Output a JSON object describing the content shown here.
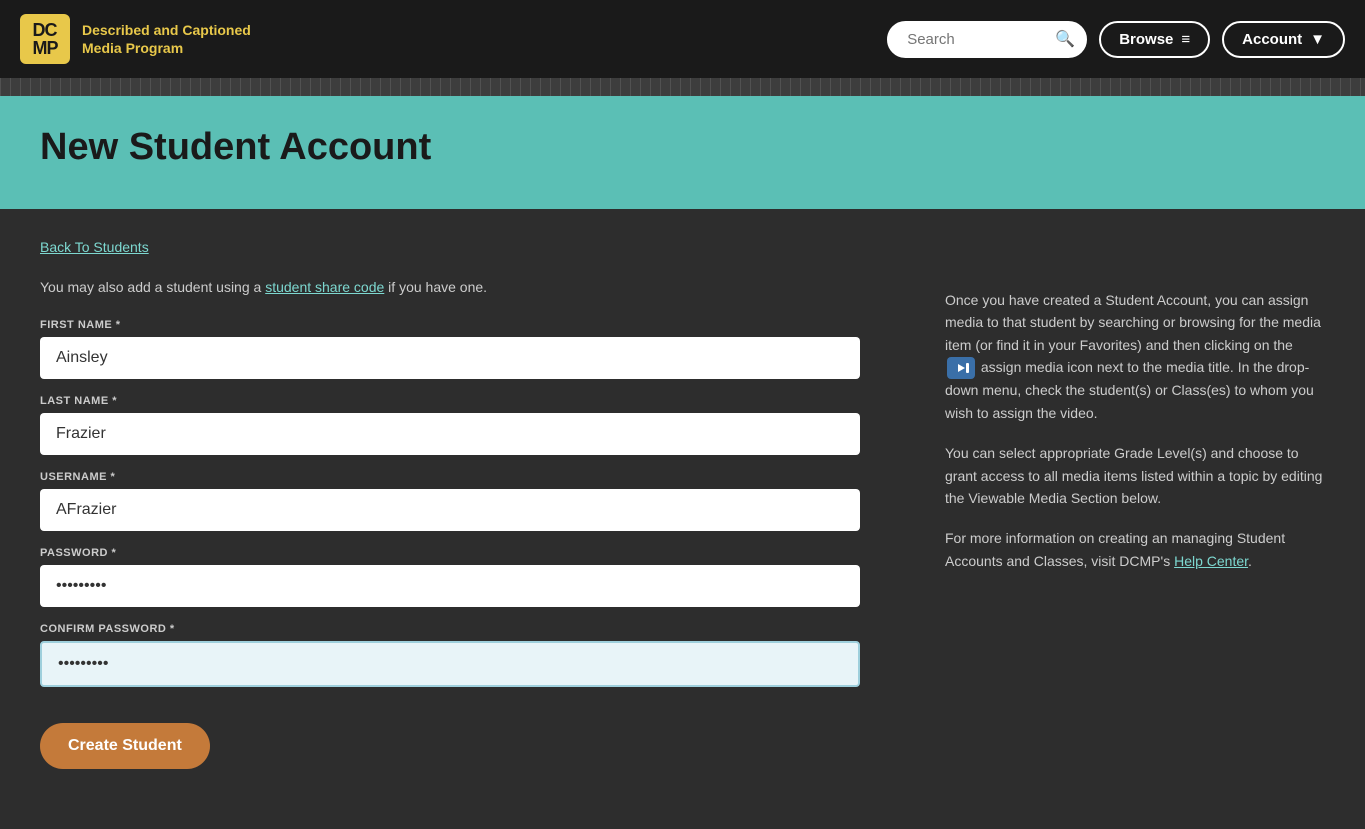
{
  "header": {
    "logo_initials": "DC\nMP",
    "logo_title_part1": "Described and Captioned",
    "logo_title_highlight": "d",
    "logo_title_part2": " Media Program",
    "search_placeholder": "Search",
    "browse_label": "Browse",
    "account_label": "Account"
  },
  "banner": {
    "title": "New Student Account"
  },
  "form": {
    "back_link": "Back To Students",
    "share_text_prefix": "You may also add a student using a ",
    "share_link": "student share code",
    "share_text_suffix": " if you have one.",
    "fields": [
      {
        "label": "FIRST NAME *",
        "value": "Ainsley",
        "type": "text",
        "name": "first-name"
      },
      {
        "label": "LAST NAME *",
        "value": "Frazier",
        "type": "text",
        "name": "last-name"
      },
      {
        "label": "USERNAME *",
        "value": "AFrazier",
        "type": "text",
        "name": "username"
      },
      {
        "label": "PASSWORD *",
        "value": "••••••••",
        "type": "password",
        "name": "password"
      },
      {
        "label": "CONFIRM PASSWORD *",
        "value": "••••••••",
        "type": "password",
        "name": "confirm-password",
        "highlight": true
      }
    ],
    "submit_label": "Create Student"
  },
  "info": {
    "paragraph1": "Once you have created a Student Account, you can assign media to that student by searching or browsing for the media item (or find it in your Favorites) and then clicking on the",
    "paragraph1_after": "assign media icon next to the media title. In the drop-down menu, check the student(s) or Class(es) to whom you wish to assign the video.",
    "paragraph2": "You can select appropriate Grade Level(s) and choose to grant access to all media items listed within a topic by editing the Viewable Media Section below.",
    "paragraph3_prefix": "For more information on creating an managing Student Accounts and Classes, visit DCMP's ",
    "paragraph3_link": "Help Center",
    "paragraph3_suffix": "."
  }
}
